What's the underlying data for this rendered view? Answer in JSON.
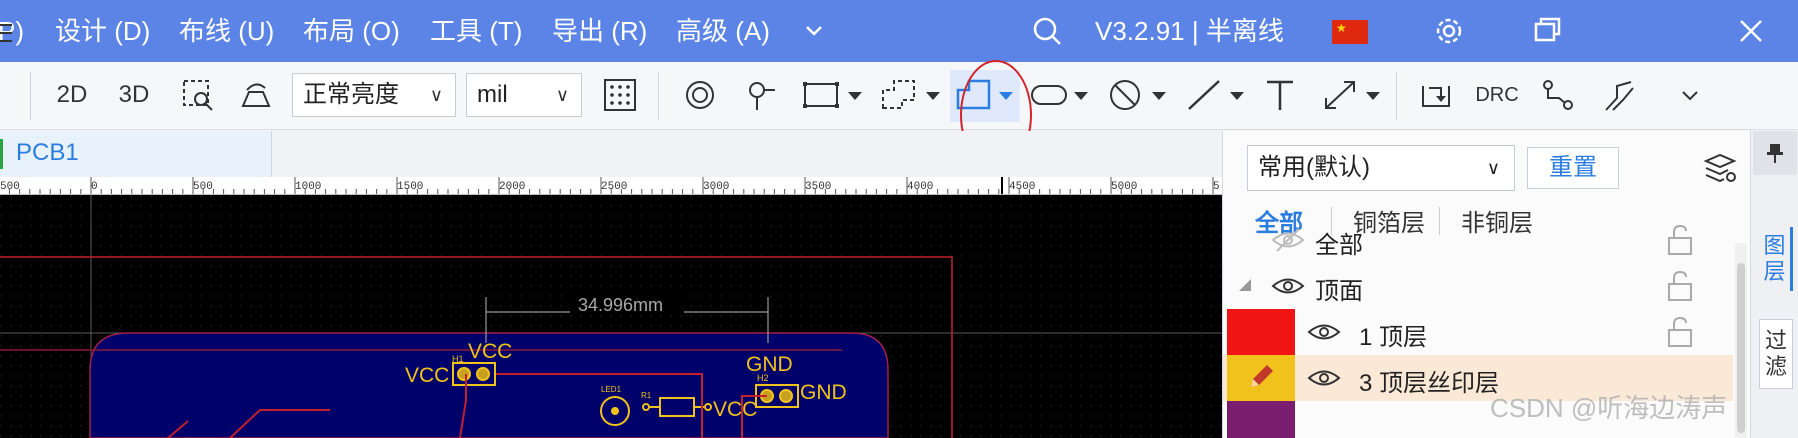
{
  "menu": {
    "items": [
      "P)",
      "设计 (D)",
      "布线 (U)",
      "布局 (O)",
      "工具 (T)",
      "导出 (R)",
      "高级 (A)"
    ],
    "version": "V3.2.91 | 半离线"
  },
  "toolbar": {
    "view_2d": "2D",
    "view_3d": "3D",
    "brightness": "正常亮度",
    "unit": "mil",
    "drc": "DRC"
  },
  "tabs": {
    "pcb": "PCB1"
  },
  "ruler": {
    "ticks": [
      "500",
      "0",
      "500",
      "1000",
      "1500",
      "2000",
      "2500",
      "3000",
      "3500",
      "4000",
      "4500",
      "5000",
      "5"
    ]
  },
  "canvas": {
    "dimension": "34.996mm",
    "labels": {
      "h1": "H1",
      "vcc_top": "VCC",
      "vcc_left": "VCC",
      "gnd_top": "GND",
      "h2": "H2",
      "gnd_right": "GND",
      "led1": "LED1",
      "r1": "R1",
      "vcc_led": "VCC"
    }
  },
  "panel": {
    "preset": "常用(默认)",
    "reset": "重置",
    "tabs": [
      "全部",
      "铜箔层",
      "非铜层"
    ],
    "rows": [
      "全部",
      "顶面",
      "1 顶层",
      "3 顶层丝印层"
    ],
    "colors": {
      "top_layer": "#f01414",
      "silk": "#f1c21b"
    }
  },
  "side_tabs": {
    "layers": "图层",
    "filter": "过滤"
  },
  "watermark": "CSDN @听海边涛声",
  "colors": {
    "menubar": "#5b84e6",
    "accent": "#2b7de0",
    "board": "#00006b",
    "annotation": "#d2252b"
  }
}
